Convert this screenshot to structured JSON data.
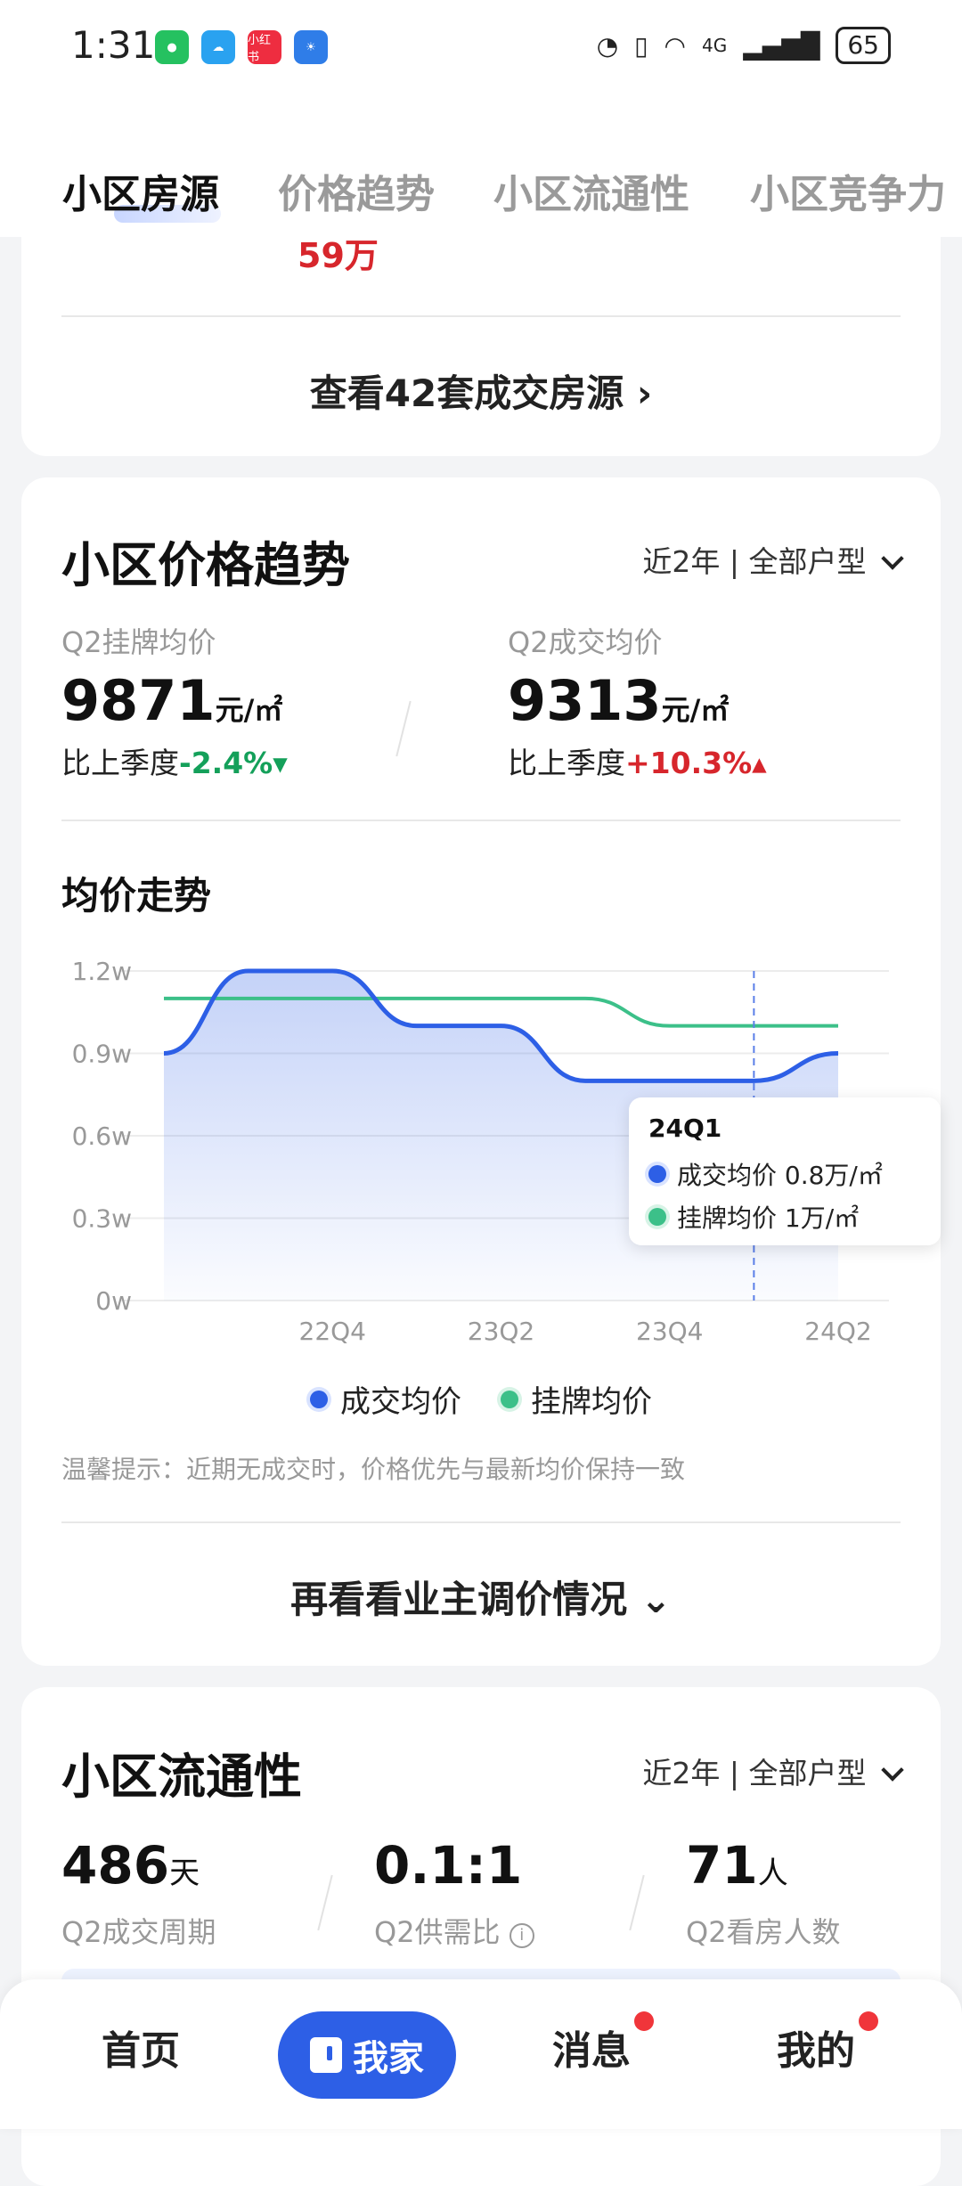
{
  "status_bar": {
    "time": "1:31",
    "battery": "65",
    "signal_text": "4G",
    "xiaohongshu_label": "小红书"
  },
  "tabs": [
    {
      "label": "小区房源",
      "active": true
    },
    {
      "label": "价格趋势",
      "active": false
    },
    {
      "label": "小区流通性",
      "active": false
    },
    {
      "label": "小区竞争力",
      "active": false
    }
  ],
  "listing": {
    "price": "59万",
    "view_all": "查看42套成交房源",
    "view_all_chevron": "›"
  },
  "price_trend": {
    "title": "小区价格趋势",
    "filter": "近2年 | 全部户型",
    "listing_label": "Q2挂牌均价",
    "listing_value": "9871",
    "listing_unit": "元/㎡",
    "listing_compare_prefix": "比上季度",
    "listing_change": "-2.4%▾",
    "deal_label": "Q2成交均价",
    "deal_value": "9313",
    "deal_unit": "元/㎡",
    "deal_compare_prefix": "比上季度",
    "deal_change": "+10.3%▴",
    "subtitle": "均价走势",
    "tooltip": {
      "title": "24Q1",
      "deal_text": "成交均价  0.8万/㎡",
      "listing_text": "挂牌均价  1万/㎡"
    },
    "legend_deal": "成交均价",
    "legend_listing": "挂牌均价",
    "tip": "温馨提示：近期无成交时，价格优先与最新均价保持一致",
    "more": "再看看业主调价情况",
    "more_chevron": "⌄"
  },
  "chart_data": {
    "type": "line",
    "x": [
      "22Q2",
      "22Q3",
      "22Q4",
      "23Q1",
      "23Q2",
      "23Q3",
      "23Q4",
      "24Q1",
      "24Q2"
    ],
    "x_tick_labels": [
      "22Q4",
      "23Q2",
      "23Q4",
      "24Q2"
    ],
    "y_tick_labels": [
      "1.2w",
      "0.9w",
      "0.6w",
      "0.3w",
      "0w"
    ],
    "ylim": [
      0,
      1.2
    ],
    "series": [
      {
        "name": "成交均价",
        "values": [
          0.9,
          1.2,
          1.2,
          1.0,
          1.0,
          0.8,
          0.8,
          0.8,
          0.9
        ],
        "color": "#2d5fe6"
      },
      {
        "name": "挂牌均价",
        "values": [
          1.1,
          1.1,
          1.1,
          1.1,
          1.1,
          1.1,
          1.0,
          1.0,
          1.0
        ],
        "color": "#3cc089"
      }
    ],
    "highlight_x": "24Q1",
    "grid": true,
    "legend": "bottom"
  },
  "liquidity": {
    "title": "小区流通性",
    "filter": "近2年 | 全部户型",
    "cycle_value": "486",
    "cycle_unit": "天",
    "cycle_label": "Q2成交周期",
    "ratio_value": "0.1:1",
    "ratio_label": "Q2供需比",
    "viewers_value": "71",
    "viewers_unit": "人",
    "viewers_label": "Q2看房人数"
  },
  "bottom_nav": {
    "home": "首页",
    "myhome": "我家",
    "messages": "消息",
    "mine": "我的"
  },
  "colors": {
    "accent": "#2d5fe6",
    "green": "#3cc089",
    "red": "#d7262c"
  }
}
